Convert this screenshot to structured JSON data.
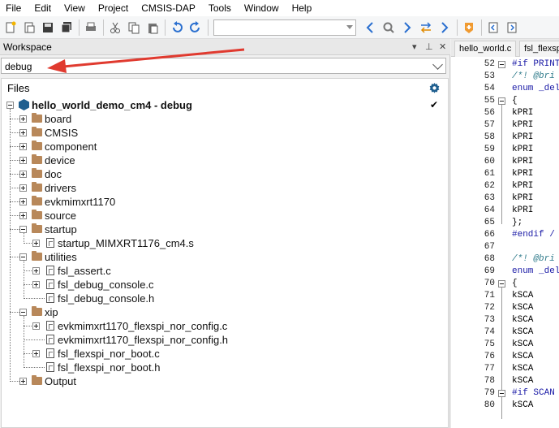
{
  "menu": [
    "File",
    "Edit",
    "View",
    "Project",
    "CMSIS-DAP",
    "Tools",
    "Window",
    "Help"
  ],
  "toolbar": {
    "icons": [
      "new-file-icon",
      "open-icon",
      "save-icon",
      "save-all-icon",
      "print-icon",
      "cut-icon",
      "copy-icon",
      "paste-icon",
      "undo-icon",
      "redo-icon",
      "nav-back-icon",
      "find-icon",
      "nav-forward-icon",
      "replace-icon",
      "next-icon",
      "bookmark-icon",
      "prev-file-icon",
      "next-file-icon"
    ],
    "combo_value": ""
  },
  "workspace": {
    "title": "Workspace",
    "pin_icon": "pin-icon",
    "close_icon": "close-icon",
    "configuration": "debug",
    "files_header": "Files",
    "project": "hello_world_demo_cm4 - debug",
    "tree": [
      {
        "label": "board",
        "type": "folder",
        "expander": "plus",
        "level": 1
      },
      {
        "label": "CMSIS",
        "type": "folder",
        "expander": "plus",
        "level": 1
      },
      {
        "label": "component",
        "type": "folder",
        "expander": "plus",
        "level": 1
      },
      {
        "label": "device",
        "type": "folder",
        "expander": "plus",
        "level": 1
      },
      {
        "label": "doc",
        "type": "folder",
        "expander": "plus",
        "level": 1
      },
      {
        "label": "drivers",
        "type": "folder",
        "expander": "plus",
        "level": 1
      },
      {
        "label": "evkmimxrt1170",
        "type": "folder",
        "expander": "plus",
        "level": 1
      },
      {
        "label": "source",
        "type": "folder",
        "expander": "plus",
        "level": 1
      },
      {
        "label": "startup",
        "type": "folder",
        "expander": "minus",
        "level": 1
      },
      {
        "label": "startup_MIMXRT1176_cm4.s",
        "type": "file",
        "expander": "plus",
        "level": 2
      },
      {
        "label": "utilities",
        "type": "folder",
        "expander": "minus",
        "level": 1
      },
      {
        "label": "fsl_assert.c",
        "type": "file",
        "expander": "plus",
        "level": 2
      },
      {
        "label": "fsl_debug_console.c",
        "type": "file",
        "expander": "plus",
        "level": 2
      },
      {
        "label": "fsl_debug_console.h",
        "type": "file",
        "expander": "none",
        "level": 2
      },
      {
        "label": "xip",
        "type": "folder",
        "expander": "minus",
        "level": 1
      },
      {
        "label": "evkmimxrt1170_flexspi_nor_config.c",
        "type": "file",
        "expander": "plus",
        "level": 2
      },
      {
        "label": "evkmimxrt1170_flexspi_nor_config.h",
        "type": "file",
        "expander": "none",
        "level": 2
      },
      {
        "label": "fsl_flexspi_nor_boot.c",
        "type": "file",
        "expander": "plus",
        "level": 2
      },
      {
        "label": "fsl_flexspi_nor_boot.h",
        "type": "file",
        "expander": "none",
        "level": 2
      },
      {
        "label": "Output",
        "type": "folder",
        "expander": "plus",
        "level": 1
      }
    ]
  },
  "editor": {
    "tabs": [
      "hello_world.c",
      "fsl_flexsp"
    ],
    "lines": [
      {
        "n": "52",
        "fold": true,
        "text": "#if PRINT",
        "cls": "kw"
      },
      {
        "n": "53",
        "fold": false,
        "text": "/*! @bri",
        "cls": "cm"
      },
      {
        "n": "54",
        "fold": false,
        "text": "enum _del",
        "cls": "kw"
      },
      {
        "n": "55",
        "fold": true,
        "text": "{",
        "cls": ""
      },
      {
        "n": "56",
        "fold": false,
        "text": "    kPRI",
        "cls": ""
      },
      {
        "n": "57",
        "fold": false,
        "text": "    kPRI",
        "cls": ""
      },
      {
        "n": "58",
        "fold": false,
        "text": "    kPRI",
        "cls": ""
      },
      {
        "n": "59",
        "fold": false,
        "text": "    kPRI",
        "cls": ""
      },
      {
        "n": "60",
        "fold": false,
        "text": "    kPRI",
        "cls": ""
      },
      {
        "n": "61",
        "fold": false,
        "text": "    kPRI",
        "cls": ""
      },
      {
        "n": "62",
        "fold": false,
        "text": "    kPRI",
        "cls": ""
      },
      {
        "n": "63",
        "fold": false,
        "text": "    kPRI",
        "cls": ""
      },
      {
        "n": "64",
        "fold": false,
        "text": "    kPRI",
        "cls": ""
      },
      {
        "n": "65",
        "fold": false,
        "text": "};",
        "cls": ""
      },
      {
        "n": "66",
        "fold": false,
        "text": "#endif /",
        "cls": "kw"
      },
      {
        "n": "67",
        "fold": false,
        "text": "",
        "cls": ""
      },
      {
        "n": "68",
        "fold": false,
        "text": "/*! @bri",
        "cls": "cm"
      },
      {
        "n": "69",
        "fold": false,
        "text": "enum _del",
        "cls": "kw"
      },
      {
        "n": "70",
        "fold": true,
        "text": "{",
        "cls": ""
      },
      {
        "n": "71",
        "fold": false,
        "text": "    kSCA",
        "cls": ""
      },
      {
        "n": "72",
        "fold": false,
        "text": "    kSCA",
        "cls": ""
      },
      {
        "n": "73",
        "fold": false,
        "text": "    kSCA",
        "cls": ""
      },
      {
        "n": "74",
        "fold": false,
        "text": "    kSCA",
        "cls": ""
      },
      {
        "n": "75",
        "fold": false,
        "text": "    kSCA",
        "cls": ""
      },
      {
        "n": "76",
        "fold": false,
        "text": "    kSCA",
        "cls": ""
      },
      {
        "n": "77",
        "fold": false,
        "text": "    kSCA",
        "cls": ""
      },
      {
        "n": "78",
        "fold": false,
        "text": "    kSCA",
        "cls": ""
      },
      {
        "n": "79",
        "fold": true,
        "text": "#if SCAN",
        "cls": "kw"
      },
      {
        "n": "80",
        "fold": false,
        "text": "    kSCA",
        "cls": ""
      }
    ]
  },
  "colors": {
    "accent_blue": "#2a6fcf",
    "annotation_red": "#e03a2f",
    "folder": "#b8885a"
  }
}
